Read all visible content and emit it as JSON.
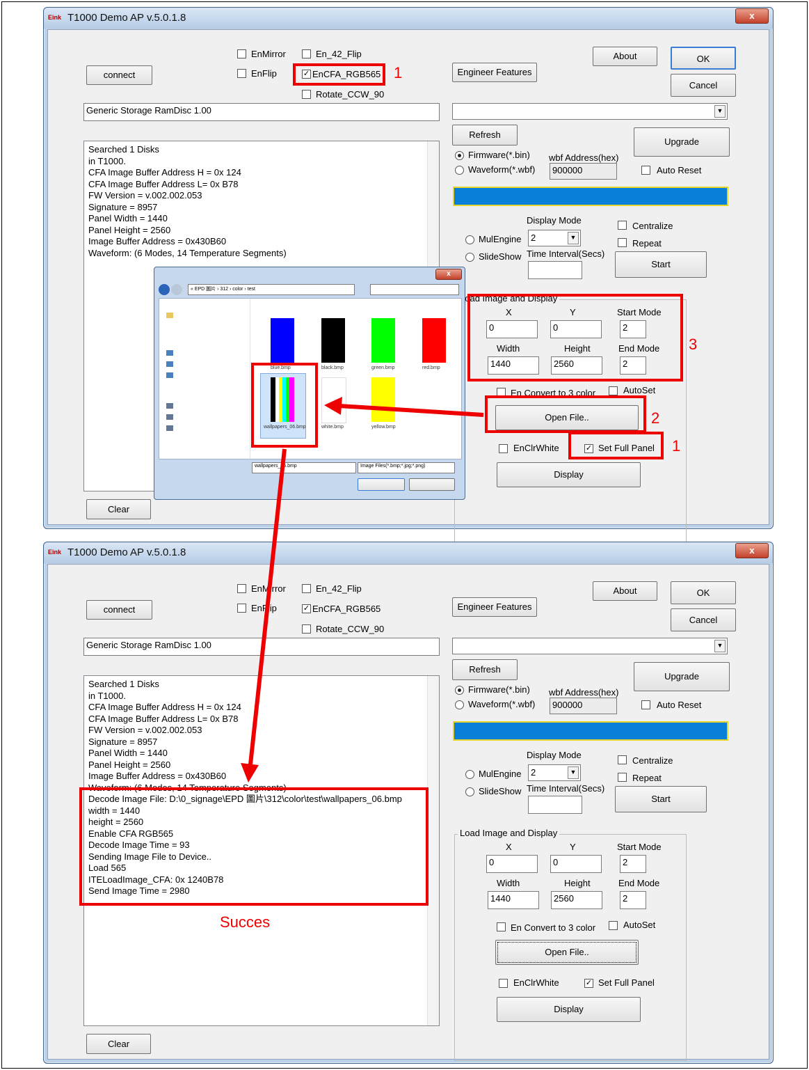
{
  "app": {
    "title": "T1000 Demo AP v.5.0.1.8",
    "logo": "Eink",
    "close_glyph": "x"
  },
  "buttons": {
    "connect": "connect",
    "about": "About",
    "ok": "OK",
    "cancel": "Cancel",
    "engineer": "Engineer Features",
    "refresh": "Refresh",
    "upgrade": "Upgrade",
    "start": "Start",
    "open_file": "Open File..",
    "display": "Display",
    "clear": "Clear"
  },
  "checkboxes": {
    "en_mirror": "EnMirror",
    "en_42_flip": "En_42_Flip",
    "en_flip": "EnFlip",
    "en_cfa": "EnCFA_RGB565",
    "rotate": "Rotate_CCW_90",
    "auto_reset": "Auto Reset",
    "centralize": "Centralize",
    "repeat": "Repeat",
    "en_convert": "En Convert to 3 color",
    "autoset": "AutoSet",
    "en_clr_white": "EnClrWhite",
    "set_full_panel": "Set Full Panel"
  },
  "radios": {
    "firmware": "Firmware(*.bin)",
    "waveform": "Waveform(*.wbf)",
    "mulengine": "MulEngine",
    "slideshow": "SlideShow"
  },
  "fields": {
    "storage": "Generic Storage RamDisc 1.00",
    "wbf_label": "wbf Address(hex)",
    "wbf_value": "900000",
    "display_mode_label": "Display Mode",
    "display_mode_value": "2",
    "time_interval_label": "Time Interval(Secs)",
    "group_label": "Load Image and Display",
    "x_label": "X",
    "y_label": "Y",
    "start_mode_label": "Start Mode",
    "x": "0",
    "y": "0",
    "start_mode": "2",
    "width_label": "Width",
    "height_label": "Height",
    "end_mode_label": "End Mode",
    "width": "1440",
    "height": "2560",
    "end_mode": "2"
  },
  "log_top": "Searched 1 Disks\nin T1000.\nCFA Image Buffer Address H = 0x 124\nCFA Image Buffer Address L= 0x B78\nFW Version = v.002.002.053\nSignature = 8957\nPanel Width = 1440\nPanel Height = 2560\nImage Buffer Address = 0x430B60\nWaveform: (6 Modes, 14 Temperature Segments)",
  "log_bottom": "Searched 1 Disks\nin T1000.\nCFA Image Buffer Address H = 0x 124\nCFA Image Buffer Address L= 0x B78\nFW Version = v.002.002.053\nSignature = 8957\nPanel Width = 1440\nPanel Height = 2560\nImage Buffer Address = 0x430B60\nWaveform: (6 Modes, 14 Temperature Segments)\nDecode Image File: D:\\0_signage\\EPD 圖片\\312\\color\\test\\wallpapers_06.bmp\nwidth = 1440\nheight = 2560\nEnable CFA RGB565\nDecode Image Time = 93\nSending Image File to Device..\nLoad 565\nITELoadImage_CFA: 0x 1240B78\nSend Image Time = 2980",
  "annotations": {
    "n1": "1",
    "n2": "2",
    "n3": "3",
    "success": "Succes"
  },
  "file_dialog": {
    "path": "« EPD 圖片 › 312 › color › test",
    "files": [
      {
        "name": "blue.bmp",
        "color": "#0000ff"
      },
      {
        "name": "black.bmp",
        "color": "#000000"
      },
      {
        "name": "green.bmp",
        "color": "#00ff00"
      },
      {
        "name": "red.bmp",
        "color": "#ff0000"
      },
      {
        "name": "wallpapers_06.bmp",
        "color": "#777777"
      },
      {
        "name": "white.bmp",
        "color": "#ffffff"
      },
      {
        "name": "yellow.bmp",
        "color": "#ffff00"
      }
    ],
    "filename": "wallpapers_06.bmp",
    "filter": "Image Files(*.bmp;*.jpg;*.png)"
  },
  "colors": {
    "annotation": "#e00000",
    "progress": "#0a7fd8",
    "progress_border": "#e8d32a"
  }
}
